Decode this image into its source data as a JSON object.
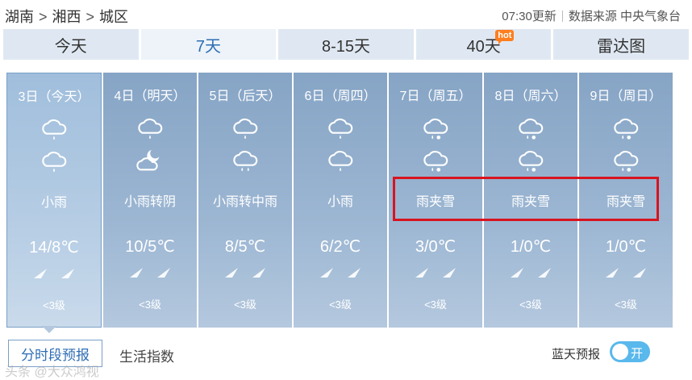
{
  "breadcrumb": {
    "province": "湖南",
    "region": "湘西",
    "area": "城区",
    "separator": ">"
  },
  "meta": {
    "update": "07:30更新",
    "source": "数据来源 中央气象台"
  },
  "tabs": [
    {
      "label": "今天"
    },
    {
      "label": "7天"
    },
    {
      "label": "8-15天"
    },
    {
      "label": "40天",
      "badge": "hot"
    },
    {
      "label": "雷达图"
    }
  ],
  "active_tab": "7天",
  "days": [
    {
      "date": "3日（今天）",
      "weather": "小雨",
      "temp": "14/8℃",
      "level": "<3级",
      "icon_day": "light-rain-icon",
      "icon_night": "light-rain-icon"
    },
    {
      "date": "4日（明天）",
      "weather": "小雨转阴",
      "temp": "10/5℃",
      "level": "<3级",
      "icon_day": "light-rain-icon",
      "icon_night": "cloudy-night-icon"
    },
    {
      "date": "5日（后天）",
      "weather": "小雨转中雨",
      "temp": "8/5℃",
      "level": "<3级",
      "icon_day": "light-rain-icon",
      "icon_night": "moderate-rain-icon"
    },
    {
      "date": "6日（周四）",
      "weather": "小雨",
      "temp": "6/2℃",
      "level": "<3级",
      "icon_day": "light-rain-icon",
      "icon_night": "light-rain-icon"
    },
    {
      "date": "7日（周五）",
      "weather": "雨夹雪",
      "temp": "3/0℃",
      "level": "<3级",
      "icon_day": "sleet-icon",
      "icon_night": "sleet-icon"
    },
    {
      "date": "8日（周六）",
      "weather": "雨夹雪",
      "temp": "1/0℃",
      "level": "<3级",
      "icon_day": "sleet-icon",
      "icon_night": "sleet-icon"
    },
    {
      "date": "9日（周日）",
      "weather": "雨夹雪",
      "temp": "1/0℃",
      "level": "<3级",
      "icon_day": "sleet-icon",
      "icon_night": "sleet-icon"
    }
  ],
  "bottom": {
    "hourly_button": "分时段预报",
    "life_index": "生活指数",
    "blue_sky": "蓝天预报",
    "toggle_state": "开"
  },
  "watermark": "头条 @大众鸿视",
  "colors": {
    "day_bg": "#8fabc9",
    "active_tab_text": "#2e6db4",
    "highlight": "#d8141f",
    "toggle": "#59b8ec",
    "hot_badge": "#ff7e1f"
  }
}
